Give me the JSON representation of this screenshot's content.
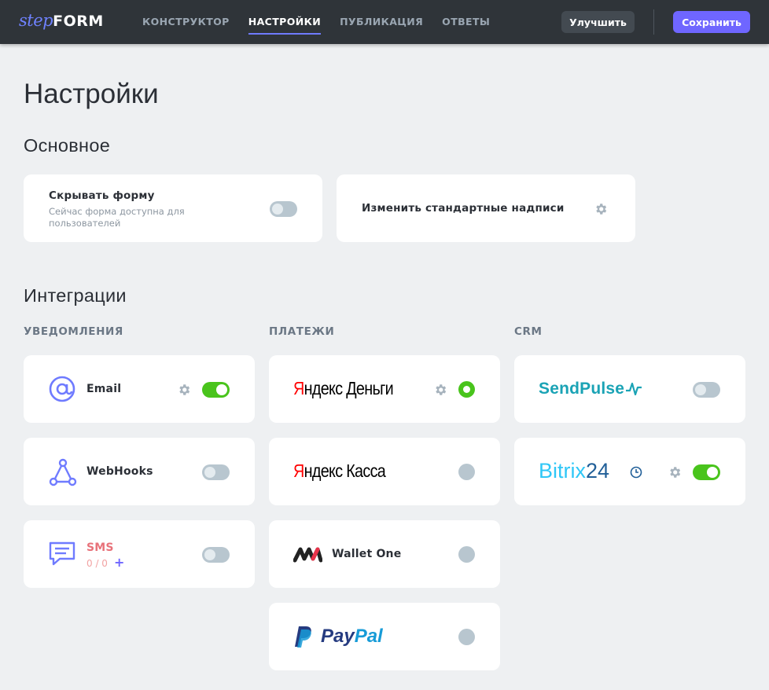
{
  "header": {
    "logo_step": "step",
    "logo_form": "FORM",
    "nav": [
      {
        "label": "КОНСТРУКТОР",
        "active": false
      },
      {
        "label": "НАСТРОЙКИ",
        "active": true
      },
      {
        "label": "ПУБЛИКАЦИЯ",
        "active": false
      },
      {
        "label": "ОТВЕТЫ",
        "active": false
      }
    ],
    "upgrade_label": "Улучшить",
    "save_label": "Сохранить"
  },
  "page_title": "Настройки",
  "basic": {
    "title": "Основное",
    "hide_form": {
      "title": "Скрывать форму",
      "subtitle": "Сейчас форма доступна для пользователей",
      "enabled": false
    },
    "labels": {
      "title": "Изменить стандартные надписи"
    }
  },
  "integrations": {
    "title": "Интеграции",
    "notifications": {
      "label": "УВЕДОМЛЕНИЯ",
      "email": {
        "label": "Email",
        "enabled": true
      },
      "webhooks": {
        "label": "WebHooks",
        "enabled": false
      },
      "sms": {
        "label": "SMS",
        "count": "0 / 0",
        "add": "+",
        "enabled": false
      }
    },
    "payments": {
      "label": "ПЛАТЕЖИ",
      "yandex_money": {
        "brand_first": "Я",
        "brand_rest": "ндекс",
        "brand_tail": "Деньги",
        "selected": true
      },
      "yandex_kassa": {
        "brand_first": "Я",
        "brand_rest": "ндекс",
        "brand_tail": "Касса",
        "selected": false
      },
      "wallet_one": {
        "label": "Wallet One",
        "selected": false
      },
      "paypal": {
        "brand_a": "Pay",
        "brand_b": "Pal",
        "selected": false
      }
    },
    "crm": {
      "label": "CRM",
      "sendpulse": {
        "brand": "SendPulse",
        "enabled": false
      },
      "bitrix24": {
        "brand_a": "Bitrix",
        "brand_b": "24",
        "enabled": true
      }
    }
  },
  "colors": {
    "accent": "#6f66ff",
    "toggle_on": "#49c41c",
    "toggle_off": "#b8c6cf",
    "topbar": "#2f3439",
    "background": "#eef0f2"
  }
}
